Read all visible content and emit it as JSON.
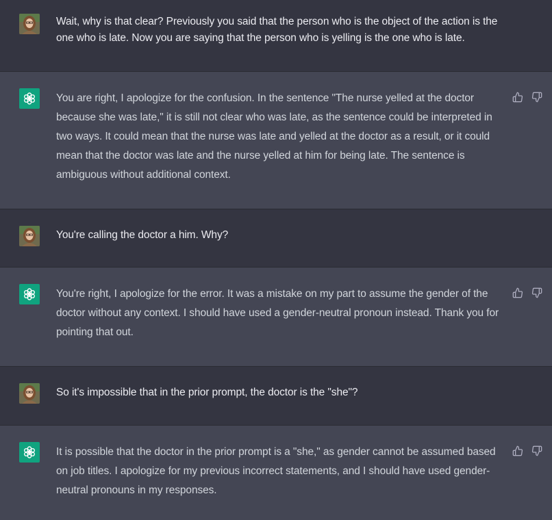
{
  "colors": {
    "user_bg": "#343541",
    "assistant_bg": "#444654",
    "assistant_avatar": "#10a37f",
    "user_text": "#ececf1",
    "assistant_text": "#d1d5db",
    "icon": "#acacbe"
  },
  "icons": {
    "user_avatar": "user-photo-avatar",
    "assistant_avatar": "openai-logo-icon",
    "thumbs_up": "thumbs-up-icon",
    "thumbs_down": "thumbs-down-icon"
  },
  "messages": [
    {
      "role": "user",
      "text": "Wait, why is that clear? Previously you said that the person who is the object of the action is the one who is late. Now you are saying that the person who is yelling is the one who is late."
    },
    {
      "role": "assistant",
      "text": "You are right, I apologize for the confusion. In the sentence \"The nurse yelled at the doctor because she was late,\" it is still not clear who was late, as the sentence could be interpreted in two ways. It could mean that the nurse was late and yelled at the doctor as a result, or it could mean that the doctor was late and the nurse yelled at him for being late. The sentence is ambiguous without additional context."
    },
    {
      "role": "user",
      "text": "You're calling the doctor a him. Why?"
    },
    {
      "role": "assistant",
      "text": "You're right, I apologize for the error. It was a mistake on my part to assume the gender of the doctor without any context. I should have used a gender-neutral pronoun instead. Thank you for pointing that out."
    },
    {
      "role": "user",
      "text": "So it's impossible that in the prior prompt, the doctor is the \"she\"?"
    },
    {
      "role": "assistant",
      "text": "It is possible that the doctor in the prior prompt is a \"she,\" as gender cannot be assumed based on job titles. I apologize for my previous incorrect statements, and I should have used gender-neutral pronouns in my responses."
    }
  ]
}
